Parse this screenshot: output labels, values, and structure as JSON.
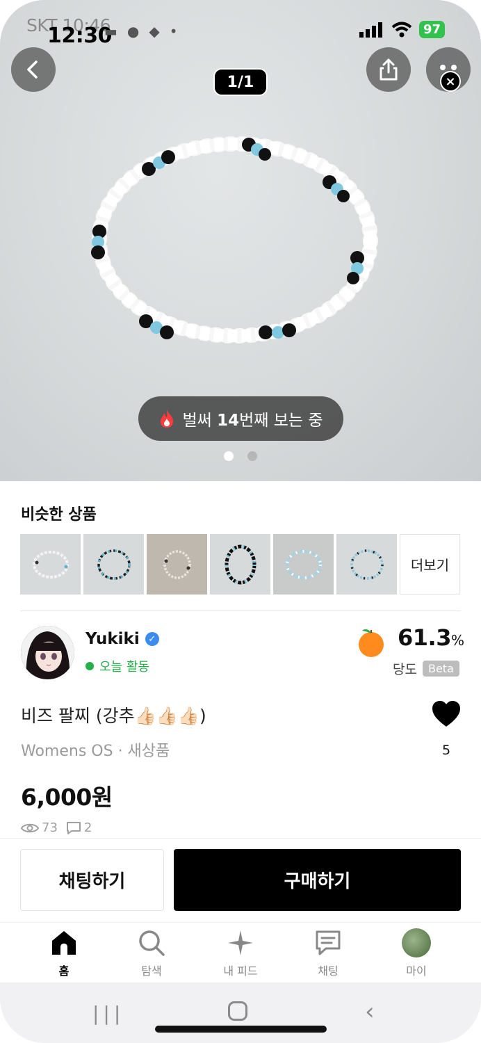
{
  "status_bar": {
    "carrier_time": "SKT 10:46",
    "time": "12:30",
    "battery": "97"
  },
  "hero": {
    "page_counter": "1/1",
    "viewers_prefix": "벌써 ",
    "viewers_count": "14",
    "viewers_suffix": "번째 보는 중"
  },
  "similar": {
    "title": "비슷한 상품",
    "more_label": "더보기"
  },
  "seller": {
    "name": "Yukiki",
    "activity": "오늘 활동",
    "sweetness_value": "61.3",
    "sweetness_unit": "%",
    "sweetness_label": "당도",
    "beta_label": "Beta"
  },
  "product": {
    "title": "비즈 팔찌 (강추👍🏻👍🏻👍🏻)",
    "meta": "Womens OS · 새상품",
    "likes": "5",
    "price": "6,000원",
    "views": "73",
    "comments": "2"
  },
  "actions": {
    "chat_label": "채팅하기",
    "buy_label": "구매하기"
  },
  "tabs": {
    "home": "홈",
    "search": "탐색",
    "feed": "내 피드",
    "chat": "채팅",
    "my": "마이"
  }
}
